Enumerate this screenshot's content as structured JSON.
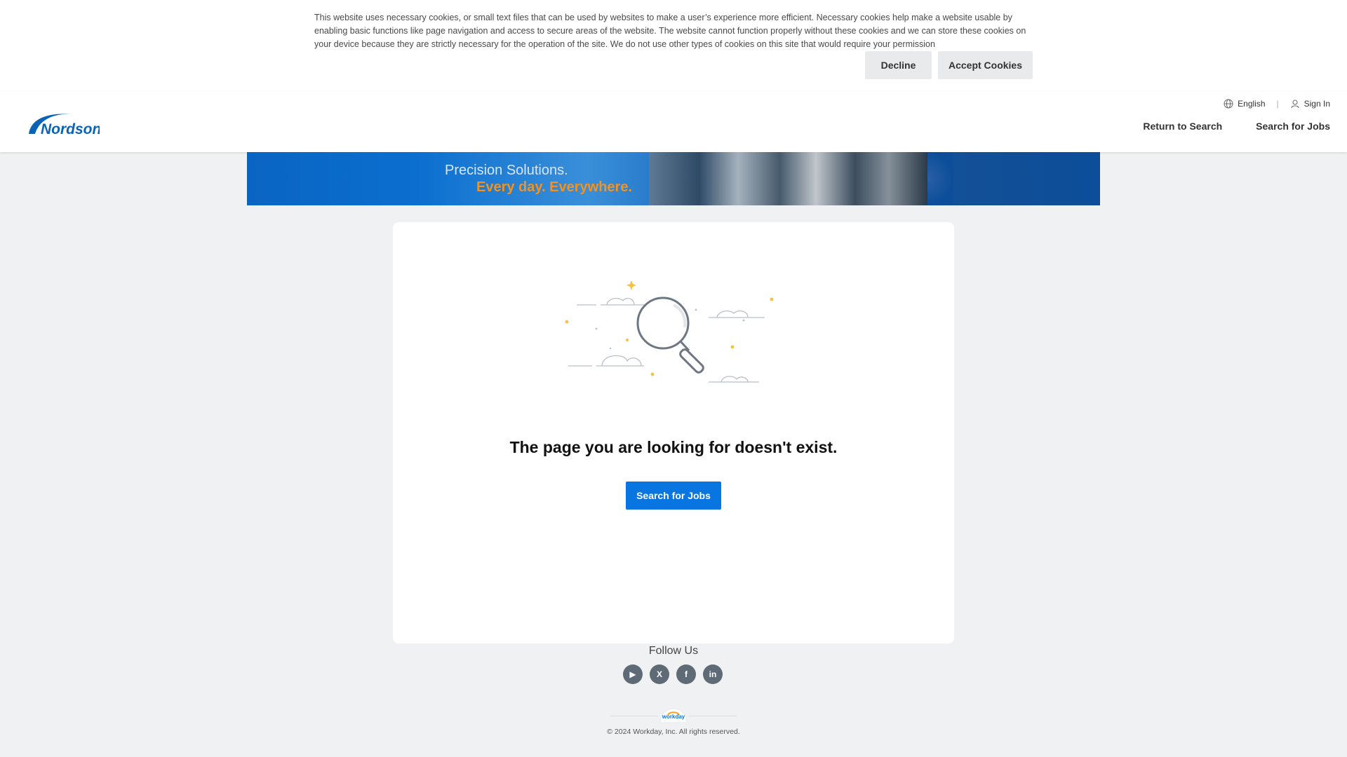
{
  "cookie_banner": {
    "text": "This website uses necessary cookies, or small text files that can be used by websites to make a user’s experience more efficient.  Necessary cookies help make a website usable by enabling basic functions like page navigation and access to secure areas of the website. The website cannot function properly without these cookies and we can store these cookies on your device because they are strictly necessary for the operation of the site.  We do not use other types of cookies on this site that would require your permission",
    "decline_label": "Decline",
    "accept_label": "Accept Cookies"
  },
  "header": {
    "logo_text": "Nordson",
    "language_label": "English",
    "language_icon": "globe-icon",
    "signin_label": "Sign In",
    "signin_icon": "user-icon",
    "nav": {
      "return_label": "Return to Search",
      "search_label": "Search for Jobs"
    }
  },
  "hero": {
    "line1": "Precision Solutions.",
    "line2": "Every day. Everywhere."
  },
  "main": {
    "error_title": "The page you are looking for doesn't exist.",
    "search_button_label": "Search for Jobs",
    "illustration_icon": "magnifier-icon"
  },
  "footer": {
    "follow_label": "Follow Us",
    "socials": [
      {
        "name": "youtube",
        "glyph": "▶"
      },
      {
        "name": "x",
        "glyph": "X"
      },
      {
        "name": "facebook",
        "glyph": "f"
      },
      {
        "name": "linkedin",
        "glyph": "in"
      }
    ],
    "workday_logo_text": "workday",
    "copyright": "© 2024 Workday, Inc. All rights reserved."
  },
  "colors": {
    "primary_button": "#0875e1",
    "brand_blue": "#0b63b6",
    "banner_orange": "#f29220",
    "page_background": "#f0f1f2"
  }
}
